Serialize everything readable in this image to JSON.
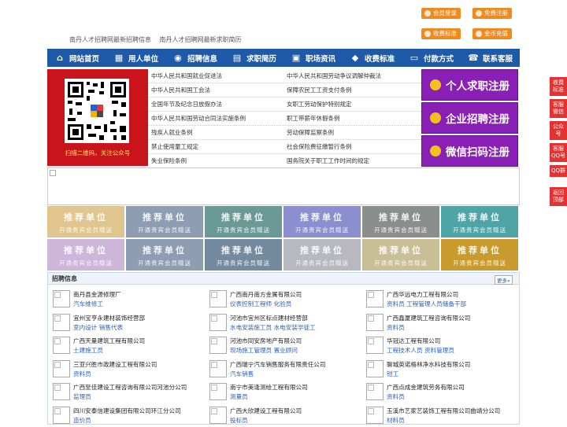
{
  "header": {
    "links": [
      "南丹人才招聘网最新招聘信息",
      "南丹人才招聘网最新求职简历"
    ],
    "buttons": [
      {
        "label": "会员登录"
      },
      {
        "label": "免费注册"
      },
      {
        "label": "收费标准"
      },
      {
        "label": "金币充值"
      }
    ]
  },
  "nav": {
    "items": [
      {
        "label": "网站首页",
        "icon": "home-icon"
      },
      {
        "label": "用人单位",
        "icon": "building-icon"
      },
      {
        "label": "招聘信息",
        "icon": "megaphone-icon"
      },
      {
        "label": "求职简历",
        "icon": "document-icon"
      },
      {
        "label": "职场资讯",
        "icon": "news-icon"
      },
      {
        "label": "收费标准",
        "icon": "tag-icon"
      },
      {
        "label": "付款方式",
        "icon": "card-icon"
      },
      {
        "label": "联系客服",
        "icon": "phone-icon"
      }
    ]
  },
  "qr": {
    "caption": "扫描二维码，关注公众号"
  },
  "laws": {
    "left": [
      "中华人民共和国就业促进法",
      "中华人民共和国工会法",
      "全国年节及纪念日放假办法",
      "中华人民共和国劳动合同法实施条例",
      "残疾人就业条例",
      "禁止使用童工规定",
      "失业保险条例"
    ],
    "right": [
      "中华人民共和国劳动争议调解仲裁法",
      "保障农民工工资支付条例",
      "女职工劳动保护特别规定",
      "职工带薪年休假条例",
      "劳动保障监察条例",
      "社会保险费征缴暂行条例",
      "国务院关于职工工作时间的规定"
    ]
  },
  "register": [
    {
      "label": "个人求职注册"
    },
    {
      "label": "企业招聘注册"
    },
    {
      "label": "微信扫码注册"
    }
  ],
  "recommend": {
    "title": "推荐单位",
    "subtitle": "开通贵宾会员赠送",
    "colors": [
      "#e0c68e",
      "#8e9db1",
      "#6b9a96",
      "#8b8fcf",
      "#8a8f8e",
      "#4fa5a6",
      "#cdb6da",
      "#8e9db1",
      "#748b9f",
      "#b8b8c0",
      "#c9bf97",
      "#c99a2e"
    ]
  },
  "jobs": {
    "title": "招聘信息",
    "more": "更多»",
    "items": [
      {
        "company": "南丹县金源修理厂",
        "positions": "汽车维修工"
      },
      {
        "company": "广西南丹南方金属有限公司",
        "positions": "仪表控制工程师 化验员"
      },
      {
        "company": "广西华远电力工程有限公司",
        "positions": "资料员 工程管理人员储备干部"
      },
      {
        "company": "宜州宝亨永建材装饰经营部",
        "positions": "室内设计 销售代表"
      },
      {
        "company": "河池市宜州区标点建材经营部",
        "positions": "水电安装施工员 水电安装学徒工"
      },
      {
        "company": "广西鑫厦建筑工程咨询有限公司",
        "positions": "资料员"
      },
      {
        "company": "广西天量建筑工程有限公司",
        "positions": "土建施工员"
      },
      {
        "company": "河池市同安房地产有限公司",
        "positions": "现场施工管理员 置业顾问"
      },
      {
        "company": "华冠达工程有限公司",
        "positions": "工程技术人员 资料管理员"
      },
      {
        "company": "三亚兴胜市政建设工程有限公司",
        "positions": "资料员"
      },
      {
        "company": "广西瑞宁汽车销售服务有限责任公司",
        "positions": "汽车销售"
      },
      {
        "company": "聊城英诺格林净水科技有限公司",
        "positions": "钳工"
      },
      {
        "company": "广西至佳建设工程咨询有限公司河池分公司",
        "positions": "监理员"
      },
      {
        "company": "南宁市美逢测绘工程有限公司",
        "positions": "测量员"
      },
      {
        "company": "广西点成金建筑劳务有限公司",
        "positions": "资料员"
      },
      {
        "company": "四川安泰信建设集团有限公司环江分公司",
        "positions": "造价员"
      },
      {
        "company": "广西大欣建设工程有限公司",
        "positions": "投标员"
      },
      {
        "company": "玉溪市艺家艺装饰工程有限公司曲靖分公司",
        "positions": "材料员"
      }
    ]
  },
  "sidebar": [
    "收费标准",
    "客服微信",
    "公众号",
    "客服QQ号",
    "QQ群",
    "返回顶部"
  ]
}
